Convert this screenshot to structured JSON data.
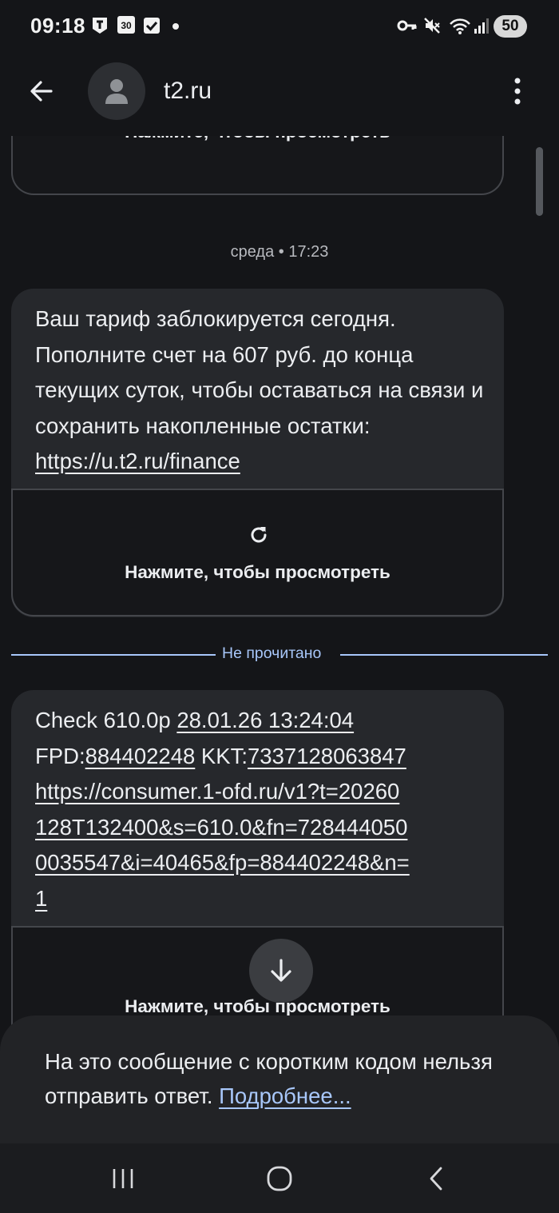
{
  "status_bar": {
    "time": "09:18",
    "calendar_day": "30",
    "battery": "50"
  },
  "app_bar": {
    "title": "t2.ru"
  },
  "messages": {
    "top_preview_label": "Нажмите, чтобы просмотреть",
    "date_separator": "среда • 17:23",
    "msg1": {
      "text": "Ваш тариф заблокируется сегодня. Пополните счет на 607 руб. до конца текущих суток, чтобы оставаться на связи и сохранить накопленные остатки: ",
      "link": "https://u.t2.ru/finance",
      "preview_label": "Нажмите, чтобы просмотреть"
    },
    "unread_label": "Не прочитано",
    "msg2": {
      "part1": "Check 610.0р ",
      "date": "28.01.26 13:24:04",
      "fpd_label": "FPD:",
      "fpd_value": "884402248",
      "kkt_label": " KKT:",
      "kkt_value": "7337128063847",
      "url": "https://consumer.1-ofd.ru/v1?t=20260128T132400&s=610.0&fn=7284440500035547&i=40465&fp=884402248&n=1",
      "preview_label": "Нажмите, чтобы просмотреть"
    }
  },
  "bottom_notice": {
    "text": "На это сообщение с коротким кодом нельзя отправить ответ. ",
    "link": "Подробнее..."
  },
  "colors": {
    "background": "#141518",
    "bubble": "#26282c",
    "accent": "#a8c7fa"
  },
  "icons": [
    "tele2-icon",
    "calendar-icon",
    "checkbox-icon",
    "key-icon",
    "mute-icon",
    "wifi-icon",
    "signal-icon",
    "back-arrow-icon",
    "person-icon",
    "more-vert-icon",
    "refresh-icon",
    "download-icon",
    "recents-icon",
    "home-icon",
    "nav-back-icon"
  ]
}
